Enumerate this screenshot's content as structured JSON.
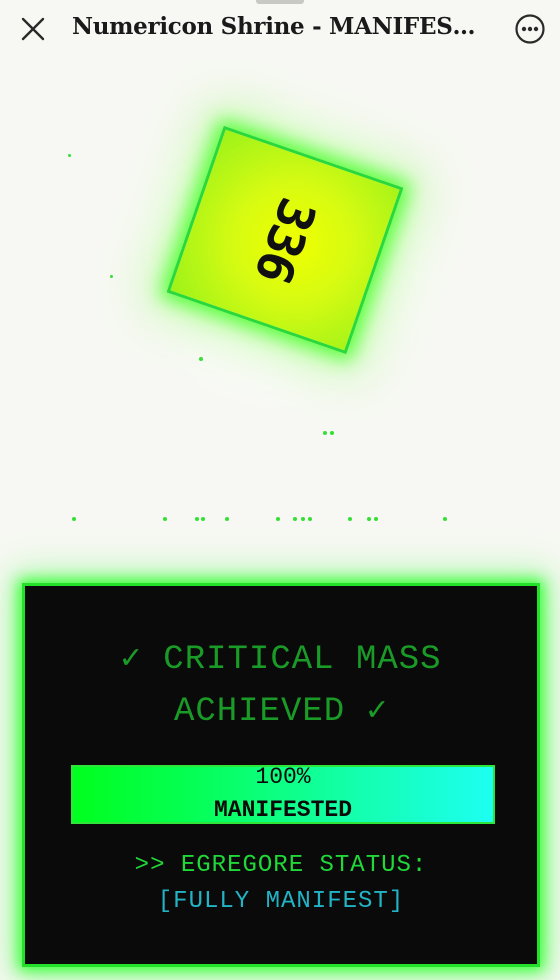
{
  "header": {
    "title": "Numericon Shrine - MANIFESTATION",
    "close_icon": "close-icon",
    "more_icon": "more-options-icon"
  },
  "numericon": {
    "number": "336"
  },
  "panel": {
    "status_title": "✓ CRITICAL MASS ACHIEVED ✓",
    "progress": {
      "percent": 100,
      "percent_label": "100%",
      "label": "MANIFESTED"
    },
    "status_line1": ">> EGREGORE STATUS:",
    "status_line2": "[FULLY MANIFEST]"
  },
  "colors": {
    "accent_green": "#25e02a",
    "cube_yellow": "#f0ff00",
    "status_cyan": "#22b3c4",
    "panel_bg": "#0a0a0a"
  }
}
